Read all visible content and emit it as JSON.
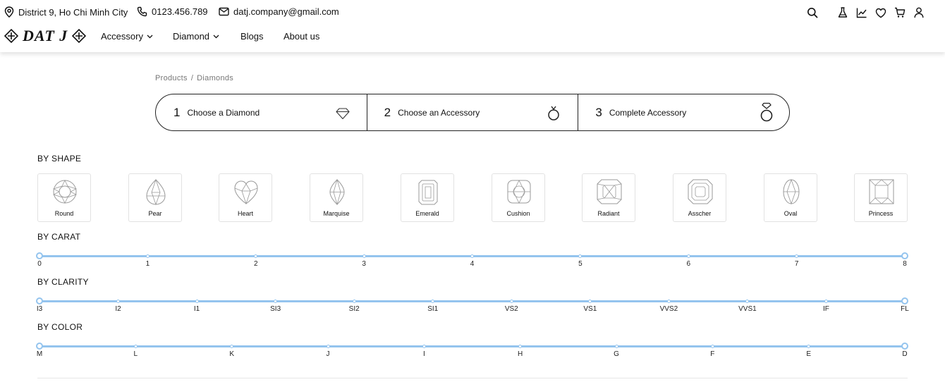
{
  "contact": {
    "address": "District 9, Ho Chi Minh City",
    "phone": "0123.456.789",
    "email": "datj.company@gmail.com"
  },
  "logo": {
    "text": "DAT J"
  },
  "nav": {
    "items": [
      {
        "label": "Accessory",
        "dropdown": true
      },
      {
        "label": "Diamond",
        "dropdown": true
      },
      {
        "label": "Blogs",
        "dropdown": false
      },
      {
        "label": "About us",
        "dropdown": false
      }
    ]
  },
  "header_icons": [
    "search-icon",
    "flask-icon",
    "chart-icon",
    "heart-icon",
    "cart-icon",
    "user-icon"
  ],
  "breadcrumb": {
    "items": [
      "Products",
      "Diamonds"
    ],
    "separator": "/"
  },
  "steps": [
    {
      "number": "1",
      "label": "Choose a Diamond",
      "icon": "diamond-icon"
    },
    {
      "number": "2",
      "label": "Choose an Accessory",
      "icon": "ring-icon"
    },
    {
      "number": "3",
      "label": "Complete Accessory",
      "icon": "diamond-ring-icon"
    }
  ],
  "filters": {
    "shape": {
      "title": "BY SHAPE",
      "options": [
        "Round",
        "Pear",
        "Heart",
        "Marquise",
        "Emerald",
        "Cushion",
        "Radiant",
        "Asscher",
        "Oval",
        "Princess"
      ]
    },
    "carat": {
      "title": "BY CARAT",
      "ticks": [
        "0",
        "1",
        "2",
        "3",
        "4",
        "5",
        "6",
        "7",
        "8"
      ],
      "selected_min": "0",
      "selected_max": "8"
    },
    "clarity": {
      "title": "BY CLARITY",
      "ticks": [
        "I3",
        "I2",
        "I1",
        "SI3",
        "SI2",
        "SI1",
        "VS2",
        "VS1",
        "VVS2",
        "VVS1",
        "IF",
        "FL"
      ],
      "selected_min": "I3",
      "selected_max": "FL"
    },
    "color": {
      "title": "BY COLOR",
      "ticks": [
        "M",
        "L",
        "K",
        "J",
        "I",
        "H",
        "G",
        "F",
        "E",
        "D"
      ],
      "selected_min": "M",
      "selected_max": "D"
    }
  },
  "colors": {
    "slider_track": "#94c4ee",
    "text": "#111111",
    "muted": "#777777",
    "border": "#222222"
  }
}
